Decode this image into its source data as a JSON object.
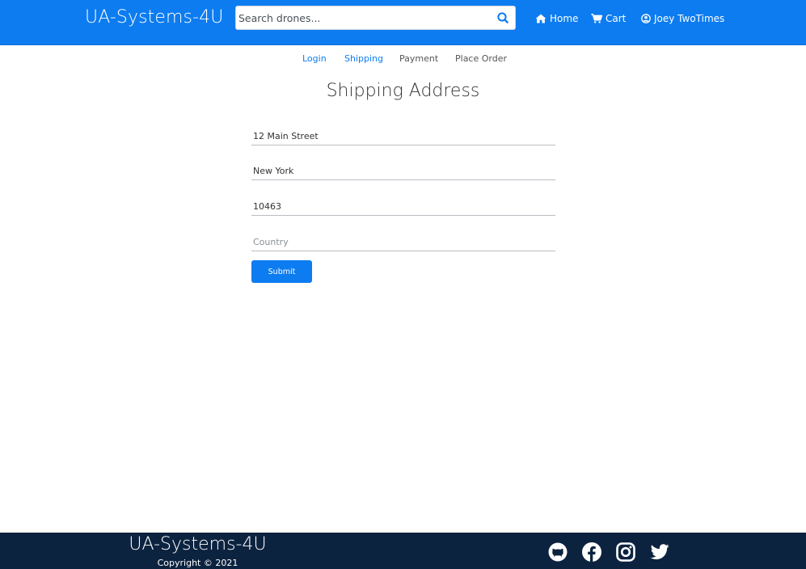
{
  "navbar": {
    "brand": "UA-Systems-4U",
    "search": {
      "placeholder": "Search drones...",
      "value": ""
    },
    "links": {
      "home": "Home",
      "cart": "Cart",
      "user": "Joey TwoTimes"
    },
    "colors": {
      "background": "#0c7cf0"
    }
  },
  "checkout_steps": {
    "login": "Login",
    "shipping": "Shipping",
    "payment": "Payment",
    "place_order": "Place Order"
  },
  "form": {
    "title": "Shipping Address",
    "address": {
      "value": "12 Main Street"
    },
    "city": {
      "value": "New York"
    },
    "postal_code": {
      "value": "10463"
    },
    "country": {
      "value": "",
      "placeholder": "Country"
    },
    "submit_label": "Submit"
  },
  "footer": {
    "brand": "UA-Systems-4U",
    "copyright": "Copyright © 2021",
    "social_icons": [
      "github-icon",
      "facebook-icon",
      "instagram-icon",
      "twitter-icon"
    ],
    "colors": {
      "background": "#0c2340"
    }
  }
}
